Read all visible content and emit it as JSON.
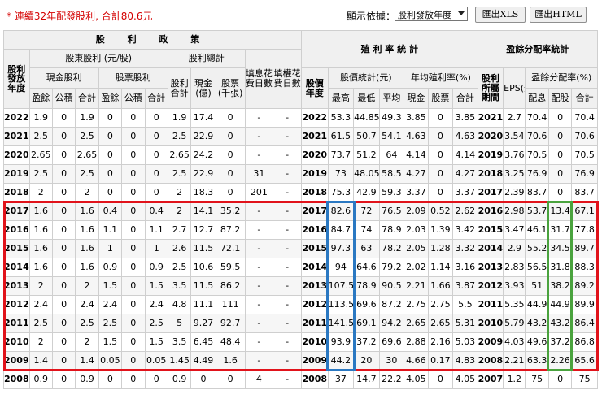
{
  "toolbar": {
    "notice": "* 連續32年配發股利, 合計80.6元",
    "view_label": "顯示依據：",
    "view_selected": "股利發放年度",
    "export_xls": "匯出XLS",
    "export_html": "匯出HTML"
  },
  "headers": {
    "dividend_policy": "股 利 政 策",
    "dividend_year": "股利發放年度",
    "shareholder_dividend": "股東股利 (元/股)",
    "dividend_total": "股利總計",
    "fill_days": "填息花費日數",
    "fill_rights_days": "填權花費日數",
    "cash_dividend": "現金股利",
    "stock_dividend": "股票股利",
    "dividend_sum": "股利合計",
    "cash_total": "現金(億)",
    "stock_total": "股票(千張)",
    "earnings": "盈餘",
    "capital_reserve": "公積",
    "subtotal": "合計",
    "yield_stats": "殖 利 率 統 計",
    "stock_year": "股價年度",
    "price_stats": "股價統計(元)",
    "avg_yield": "年均殖利率(%)",
    "high": "最高",
    "low": "最低",
    "average": "平均",
    "cash": "現金",
    "stock": "股票",
    "payout_stats": "盈餘分配率統計",
    "earn_period": "股利所屬期間",
    "eps": "EPS(元)",
    "payout_ratio": "盈餘分配率(%)",
    "payout_cash": "配息",
    "payout_stock": "配股"
  },
  "rows": [
    [
      "2022",
      "1.9",
      "0",
      "1.9",
      "0",
      "0",
      "0",
      "1.9",
      "17.4",
      "0",
      "-",
      "-",
      "2022",
      "53.3",
      "44.85",
      "49.3",
      "3.85",
      "0",
      "3.85",
      "2021",
      "2.7",
      "70.4",
      "0",
      "70.4"
    ],
    [
      "2021",
      "2.5",
      "0",
      "2.5",
      "0",
      "0",
      "0",
      "2.5",
      "22.9",
      "0",
      "-",
      "-",
      "2021",
      "61.5",
      "50.7",
      "54.1",
      "4.63",
      "0",
      "4.63",
      "2020",
      "3.54",
      "70.6",
      "0",
      "70.6"
    ],
    [
      "2020",
      "2.65",
      "0",
      "2.65",
      "0",
      "0",
      "0",
      "2.65",
      "24.2",
      "0",
      "-",
      "-",
      "2020",
      "73.7",
      "51.2",
      "64",
      "4.14",
      "0",
      "4.14",
      "2019",
      "3.76",
      "70.5",
      "0",
      "70.5"
    ],
    [
      "2019",
      "2.5",
      "0",
      "2.5",
      "0",
      "0",
      "0",
      "2.5",
      "22.9",
      "0",
      "31",
      "-",
      "2019",
      "73",
      "48.05",
      "58.5",
      "4.27",
      "0",
      "4.27",
      "2018",
      "3.25",
      "76.9",
      "0",
      "76.9"
    ],
    [
      "2018",
      "2",
      "0",
      "2",
      "0",
      "0",
      "0",
      "2",
      "18.3",
      "0",
      "201",
      "-",
      "2018",
      "75.3",
      "42.9",
      "59.3",
      "3.37",
      "0",
      "3.37",
      "2017",
      "2.39",
      "83.7",
      "0",
      "83.7"
    ],
    [
      "2017",
      "1.6",
      "0",
      "1.6",
      "0.4",
      "0",
      "0.4",
      "2",
      "14.1",
      "35.2",
      "-",
      "-",
      "2017",
      "82.6",
      "72",
      "76.5",
      "2.09",
      "0.52",
      "2.62",
      "2016",
      "2.98",
      "53.7",
      "13.4",
      "67.1"
    ],
    [
      "2016",
      "1.6",
      "0",
      "1.6",
      "1.1",
      "0",
      "1.1",
      "2.7",
      "12.7",
      "87.2",
      "-",
      "-",
      "2016",
      "84.7",
      "74",
      "78.9",
      "2.03",
      "1.39",
      "3.42",
      "2015",
      "3.47",
      "46.1",
      "31.7",
      "77.8"
    ],
    [
      "2015",
      "1.6",
      "0",
      "1.6",
      "1",
      "0",
      "1",
      "2.6",
      "11.5",
      "72.1",
      "-",
      "-",
      "2015",
      "97.3",
      "63",
      "78.2",
      "2.05",
      "1.28",
      "3.32",
      "2014",
      "2.9",
      "55.2",
      "34.5",
      "89.7"
    ],
    [
      "2014",
      "1.6",
      "0",
      "1.6",
      "0.9",
      "0",
      "0.9",
      "2.5",
      "10.6",
      "59.5",
      "-",
      "-",
      "2014",
      "94",
      "64.6",
      "79.2",
      "2.02",
      "1.14",
      "3.16",
      "2013",
      "2.83",
      "56.5",
      "31.8",
      "88.3"
    ],
    [
      "2013",
      "2",
      "0",
      "2",
      "1.5",
      "0",
      "1.5",
      "3.5",
      "11.5",
      "86.2",
      "-",
      "-",
      "2013",
      "107.5",
      "78.9",
      "90.5",
      "2.21",
      "1.66",
      "3.87",
      "2012",
      "3.93",
      "51",
      "38.2",
      "89.2"
    ],
    [
      "2012",
      "2.4",
      "0",
      "2.4",
      "2.4",
      "0",
      "2.4",
      "4.8",
      "11.1",
      "111",
      "-",
      "-",
      "2012",
      "113.5",
      "69.6",
      "87.2",
      "2.75",
      "2.75",
      "5.5",
      "2011",
      "5.35",
      "44.9",
      "44.9",
      "89.9"
    ],
    [
      "2011",
      "2.5",
      "0",
      "2.5",
      "2.5",
      "0",
      "2.5",
      "5",
      "9.27",
      "92.7",
      "-",
      "-",
      "2011",
      "141.5",
      "69.1",
      "94.2",
      "2.65",
      "2.65",
      "5.31",
      "2010",
      "5.79",
      "43.2",
      "43.2",
      "86.4"
    ],
    [
      "2010",
      "2",
      "0",
      "2",
      "1.5",
      "0",
      "1.5",
      "3.5",
      "6.45",
      "48.4",
      "-",
      "-",
      "2010",
      "93.9",
      "37.2",
      "69.6",
      "2.88",
      "2.16",
      "5.03",
      "2009",
      "4.03",
      "49.6",
      "37.2",
      "86.8"
    ],
    [
      "2009",
      "1.4",
      "0",
      "1.4",
      "0.05",
      "0",
      "0.05",
      "1.45",
      "4.49",
      "1.6",
      "-",
      "-",
      "2009",
      "44.2",
      "20",
      "30",
      "4.66",
      "0.17",
      "4.83",
      "2008",
      "2.21",
      "63.3",
      "2.26",
      "65.6"
    ],
    [
      "2008",
      "0.9",
      "0",
      "0.9",
      "0",
      "0",
      "0",
      "0.9",
      "0",
      "0",
      "4",
      "-",
      "2008",
      "37",
      "14.7",
      "22.2",
      "4.05",
      "0",
      "4.05",
      "2007",
      "1.2",
      "75",
      "0",
      "75"
    ]
  ]
}
